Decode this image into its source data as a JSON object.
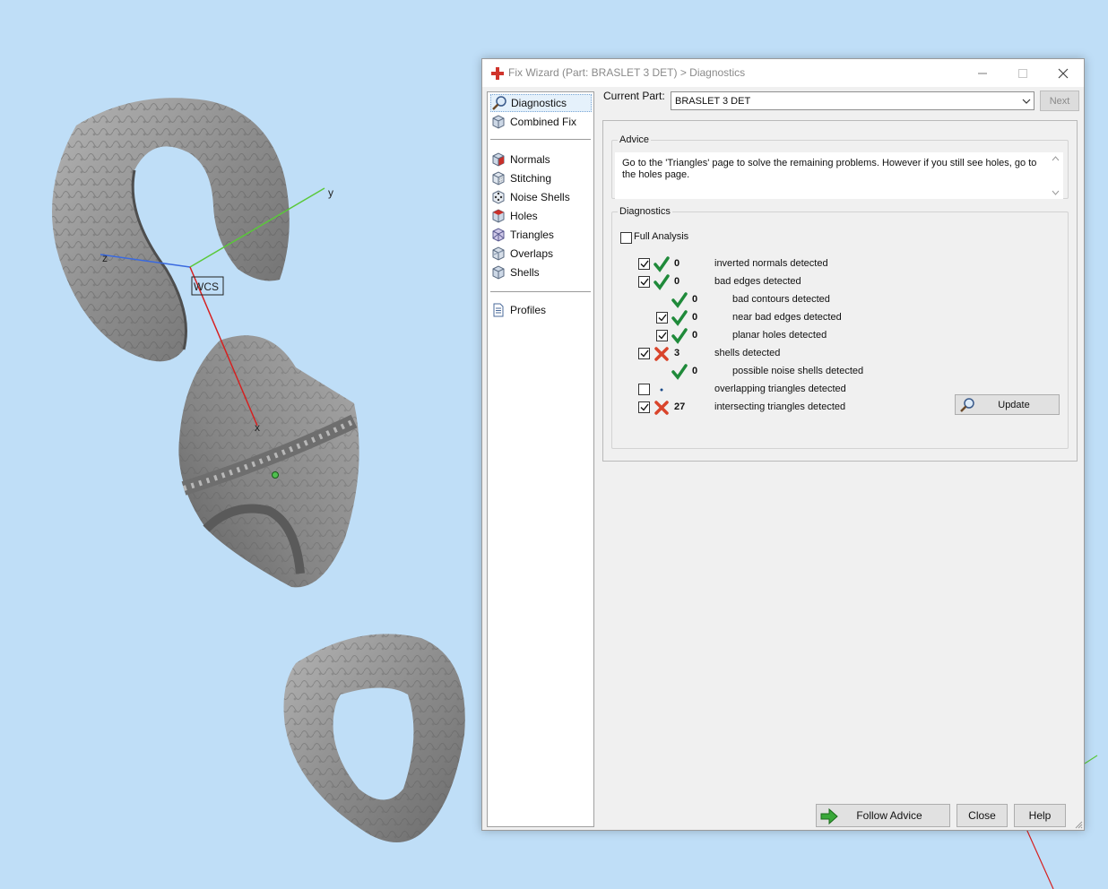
{
  "viewport": {
    "wcs_label": "WCS",
    "axis_labels": {
      "y": "y",
      "z": "z",
      "x": "x"
    },
    "colors": {
      "background": "#bfdef7",
      "model": "#8a8a8a",
      "x_axis": "#d62020",
      "y_axis": "#5ac83a",
      "z_axis": "#3a6ae0"
    }
  },
  "dialog": {
    "title": "Fix Wizard (Part: BRASLET 3 DET) > Diagnostics",
    "icon": "red-cross-icon",
    "window_controls": [
      "minimize-icon",
      "maximize-icon",
      "close-icon"
    ]
  },
  "nav": {
    "top_items": [
      {
        "label": "Diagnostics",
        "icon": "magnifier-icon",
        "selected": true
      },
      {
        "label": "Combined Fix",
        "icon": "cube-icon"
      }
    ],
    "tool_items": [
      {
        "label": "Normals",
        "icon": "normals-cube-icon"
      },
      {
        "label": "Stitching",
        "icon": "stitching-cube-icon"
      },
      {
        "label": "Noise Shells",
        "icon": "dice-icon"
      },
      {
        "label": "Holes",
        "icon": "holes-cube-icon"
      },
      {
        "label": "Triangles",
        "icon": "triangles-cube-icon"
      },
      {
        "label": "Overlaps",
        "icon": "overlaps-cube-icon"
      },
      {
        "label": "Shells",
        "icon": "shells-cube-icon"
      }
    ],
    "bottom_items": [
      {
        "label": "Profiles",
        "icon": "document-icon"
      }
    ]
  },
  "current_part": {
    "label": "Current Part:",
    "value": "BRASLET 3 DET",
    "next_label": "Next"
  },
  "advice": {
    "legend": "Advice",
    "text": "Go to the 'Triangles' page to solve the remaining problems. However if you still see holes, go to the holes page."
  },
  "diagnostics": {
    "legend": "Diagnostics",
    "full_analysis": {
      "label": "Full Analysis",
      "checked": false
    },
    "rows": [
      {
        "checkbox": true,
        "checked": true,
        "status": "ok",
        "count": "0",
        "label": "inverted normals detected",
        "indent": 0
      },
      {
        "checkbox": true,
        "checked": true,
        "status": "ok",
        "count": "0",
        "label": "bad edges detected",
        "indent": 0
      },
      {
        "checkbox": false,
        "checked": false,
        "status": "ok",
        "count": "0",
        "label": "bad contours detected",
        "indent": 1
      },
      {
        "checkbox": true,
        "checked": true,
        "status": "ok",
        "count": "0",
        "label": "near bad edges detected",
        "indent": 1
      },
      {
        "checkbox": true,
        "checked": true,
        "status": "ok",
        "count": "0",
        "label": "planar holes detected",
        "indent": 1
      },
      {
        "checkbox": true,
        "checked": true,
        "status": "error",
        "count": "3",
        "label": "shells detected",
        "indent": 0
      },
      {
        "checkbox": false,
        "checked": false,
        "status": "ok",
        "count": "0",
        "label": "possible noise shells detected",
        "indent": 1
      },
      {
        "checkbox": true,
        "checked": false,
        "status": "none",
        "count": "",
        "label": "overlapping triangles detected",
        "indent": 0
      },
      {
        "checkbox": true,
        "checked": true,
        "status": "error",
        "count": "27",
        "label": "intersecting triangles detected",
        "indent": 0
      }
    ],
    "update_label": "Update"
  },
  "buttons": {
    "follow_advice": "Follow Advice",
    "close": "Close",
    "help": "Help"
  },
  "colors": {
    "ok_check": "#1f8a3a",
    "error_cross": "#d9442b",
    "follow_arrow": "#3aa83a"
  }
}
